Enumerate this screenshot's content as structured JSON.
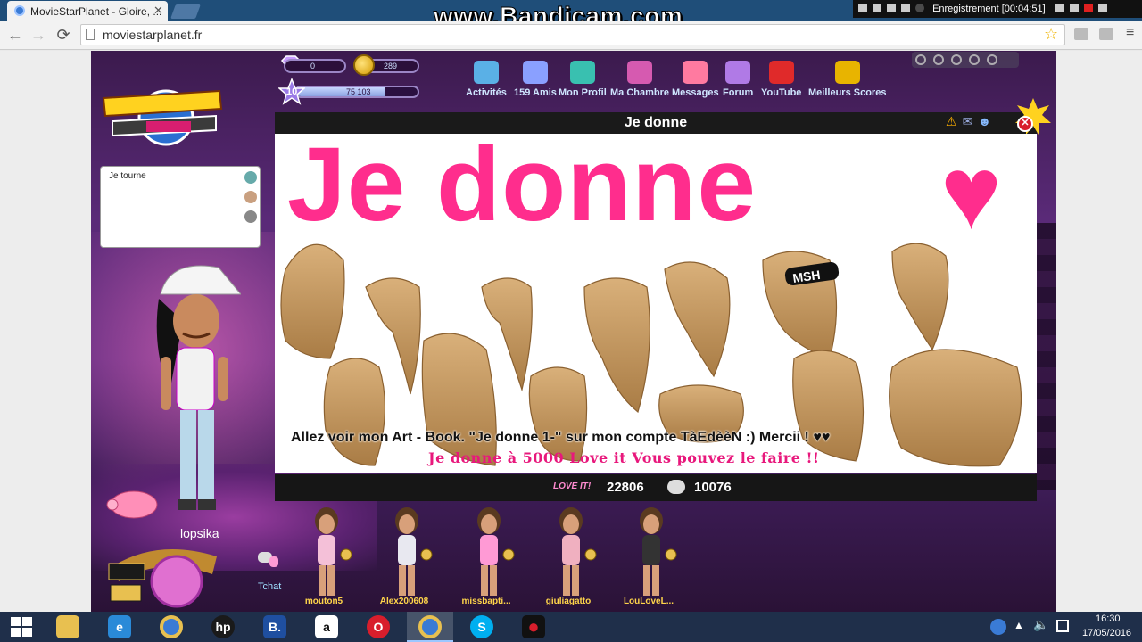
{
  "browser": {
    "tab_title": "MovieStarPlanet - Gloire, ...",
    "tab_close": "✕",
    "address": "moviestarplanet.fr",
    "back": "←",
    "forward": "→",
    "reload": "⟳",
    "star": "☆",
    "menu": "≡"
  },
  "recorder": {
    "watermark": "www.Bandicam.com",
    "status": "Enregistrement [00:04:51]"
  },
  "hud": {
    "diamonds": "0",
    "coins": "289",
    "level": "10",
    "xp_text": "75 103",
    "xp_fraction": 0.73
  },
  "nav": [
    {
      "label": "Activités",
      "icon": "activities-icon",
      "color": "#5ab0e6"
    },
    {
      "label": "159 Amis",
      "icon": "friends-icon",
      "color": "#8aa0ff"
    },
    {
      "label": "Mon Profil",
      "icon": "profile-icon",
      "color": "#39c0b0"
    },
    {
      "label": "Ma Chambre",
      "icon": "room-icon",
      "color": "#d65ab0"
    },
    {
      "label": "Messages",
      "icon": "messages-icon",
      "color": "#ff7aa0"
    },
    {
      "label": "Forum",
      "icon": "forum-icon",
      "color": "#b07ae6"
    },
    {
      "label": "YouTube",
      "icon": "youtube-icon",
      "color": "#e02a2a"
    },
    {
      "label": "Meilleurs Scores",
      "icon": "trophy-icon",
      "color": "#e8b400"
    }
  ],
  "chat": {
    "text": "Je tourne"
  },
  "player": {
    "name": "lopsika",
    "tchat_label": "Tchat"
  },
  "artbook": {
    "header": "Je donne",
    "big_title": "Je donne",
    "heart": "♥",
    "line1": "Allez voir mon Art - Book. \"Je donne 1-\" sur mon compte TàEdèèN :) Mercii ! ♥♥",
    "line2": "Je donne à 5000 Love it  Vous pouvez le faire !!",
    "love_logo": "LOVE IT!",
    "love_count": "22806",
    "comment_count": "10076"
  },
  "friends": [
    {
      "name": "mouton5"
    },
    {
      "name": "Alex200608"
    },
    {
      "name": "missbapti..."
    },
    {
      "name": "giuliagatto"
    },
    {
      "name": "LouLoveL..."
    }
  ],
  "taskbar": {
    "apps": [
      {
        "icon": "explorer-icon",
        "label": "",
        "color": "#e8c050"
      },
      {
        "icon": "ie-icon",
        "label": "e",
        "color": "#2a8ad8"
      },
      {
        "icon": "chrome-icon",
        "label": "",
        "color": "#3a7bd5"
      },
      {
        "icon": "hp-icon",
        "label": "hp",
        "color": "#1a1a1a"
      },
      {
        "icon": "booking-icon",
        "label": "B.",
        "color": "#1f4fa0"
      },
      {
        "icon": "amazon-icon",
        "label": "a",
        "color": "#ffffff"
      },
      {
        "icon": "opera-icon",
        "label": "O",
        "color": "#d81e2c"
      },
      {
        "icon": "chrome-active-icon",
        "label": "",
        "color": "#3a7bd5"
      },
      {
        "icon": "skype-icon",
        "label": "S",
        "color": "#00aff0"
      },
      {
        "icon": "bandicam-icon",
        "label": "●",
        "color": "#111111"
      }
    ],
    "time": "16:30",
    "date": "17/05/2016"
  }
}
